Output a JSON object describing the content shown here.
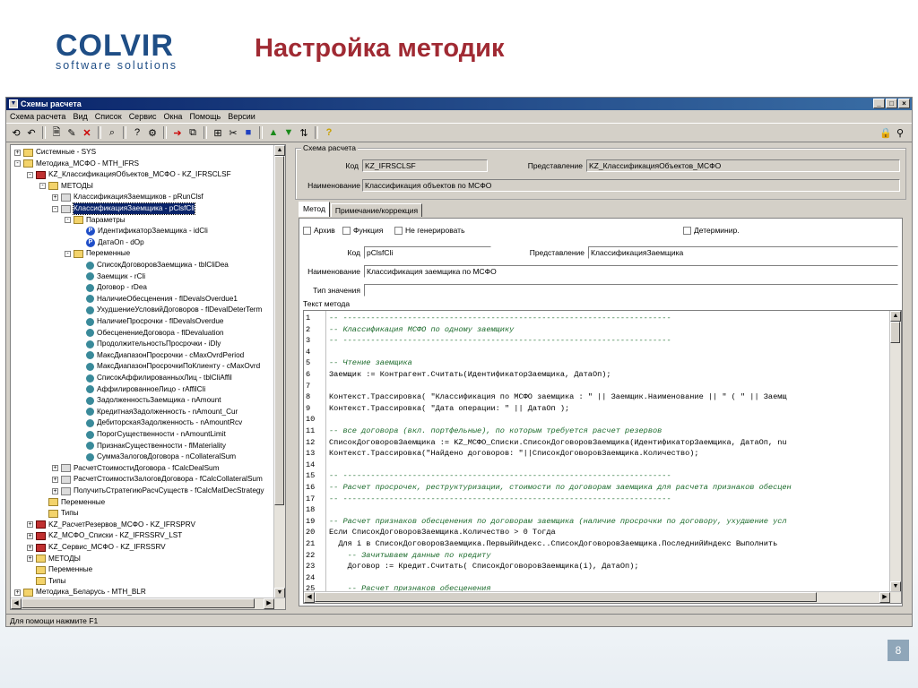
{
  "slide": {
    "logo_top": "COLVIR",
    "logo_bottom": "software solutions",
    "title": "Настройка методик",
    "page_number": "8"
  },
  "window": {
    "title": "Схемы расчета",
    "menu": [
      "Схема расчета",
      "Вид",
      "Список",
      "Сервис",
      "Окна",
      "Помощь",
      "Версии"
    ],
    "status": "Для помощи нажмите F1"
  },
  "tree": [
    {
      "text": "Системные - SYS",
      "indent": 0,
      "exp": "+",
      "icon": "folder"
    },
    {
      "text": "Методика_МСФО - MTH_IFRS",
      "indent": 0,
      "exp": "-",
      "icon": "folder"
    },
    {
      "text": "KZ_КлассификацияОбъектов_МСФО - KZ_IFRSCLSF",
      "indent": 1,
      "exp": "-",
      "icon": "db"
    },
    {
      "text": "МЕТОДЫ",
      "indent": 2,
      "exp": "-",
      "icon": "folder"
    },
    {
      "text": "КлассификацияЗаемщиков - pRunClsf",
      "indent": 3,
      "exp": "+",
      "icon": "paper"
    },
    {
      "text": "КлассификацияЗаемщика - pClsfCli",
      "indent": 3,
      "exp": "-",
      "icon": "paper",
      "selected": true
    },
    {
      "text": "Параметры",
      "indent": 4,
      "exp": "-",
      "icon": "folder"
    },
    {
      "text": "ИдентификаторЗаемщика - idCli",
      "indent": 5,
      "exp": "",
      "icon": "p"
    },
    {
      "text": "ДатаОп - dOp",
      "indent": 5,
      "exp": "",
      "icon": "p"
    },
    {
      "text": "Переменные",
      "indent": 4,
      "exp": "-",
      "icon": "folder"
    },
    {
      "text": "СписокДоговоровЗаемщика - tblCliDea",
      "indent": 5,
      "exp": "",
      "icon": "gear"
    },
    {
      "text": "Заемщик - rCli",
      "indent": 5,
      "exp": "",
      "icon": "gear"
    },
    {
      "text": "Договор - rDea",
      "indent": 5,
      "exp": "",
      "icon": "gear"
    },
    {
      "text": "НаличиеОбесценения - flDevalsOverdue1",
      "indent": 5,
      "exp": "",
      "icon": "gear"
    },
    {
      "text": "УхудшениеУсловийДоговоров - flDevalDeterTerm",
      "indent": 5,
      "exp": "",
      "icon": "gear"
    },
    {
      "text": "НаличиеПросрочки - flDevalsOverdue",
      "indent": 5,
      "exp": "",
      "icon": "gear"
    },
    {
      "text": "ОбесценениеДоговора - flDevaluation",
      "indent": 5,
      "exp": "",
      "icon": "gear"
    },
    {
      "text": "ПродолжительностьПросрочки - iDly",
      "indent": 5,
      "exp": "",
      "icon": "gear"
    },
    {
      "text": "МаксДиапазонПросрочки - cMaxOvrdPeriod",
      "indent": 5,
      "exp": "",
      "icon": "gear"
    },
    {
      "text": "МаксДиапазонПросрочкиПоКлиенту - cMaxOvrd",
      "indent": 5,
      "exp": "",
      "icon": "gear"
    },
    {
      "text": "СписокАффилированныхЛиц - tblCliAffil",
      "indent": 5,
      "exp": "",
      "icon": "gear"
    },
    {
      "text": "АффилированноеЛицо - rAffilCli",
      "indent": 5,
      "exp": "",
      "icon": "gear"
    },
    {
      "text": "ЗадолженностьЗаемщика - nAmount",
      "indent": 5,
      "exp": "",
      "icon": "gear"
    },
    {
      "text": "КредитнаяЗадолженность - nAmount_Cur",
      "indent": 5,
      "exp": "",
      "icon": "gear"
    },
    {
      "text": "ДебиторскаяЗадолженность - nAmountRcv",
      "indent": 5,
      "exp": "",
      "icon": "gear"
    },
    {
      "text": "ПорогСущественности - nAmountLimit",
      "indent": 5,
      "exp": "",
      "icon": "gear"
    },
    {
      "text": "ПризнакСущественности - flMateriality",
      "indent": 5,
      "exp": "",
      "icon": "gear"
    },
    {
      "text": "СуммаЗалоговДоговора - nCollateralSum",
      "indent": 5,
      "exp": "",
      "icon": "gear"
    },
    {
      "text": "РасчетСтоимостиДоговора - fCalcDealSum",
      "indent": 3,
      "exp": "+",
      "icon": "paper"
    },
    {
      "text": "РасчетСтоимостиЗалоговДоговора - fCalcCollateralSum",
      "indent": 3,
      "exp": "+",
      "icon": "paper"
    },
    {
      "text": "ПолучитьСтратегиюРасчСуществ - fCalcMatDecStrategy",
      "indent": 3,
      "exp": "+",
      "icon": "paper"
    },
    {
      "text": "Переменные",
      "indent": 2,
      "exp": "",
      "icon": "folder"
    },
    {
      "text": "Типы",
      "indent": 2,
      "exp": "",
      "icon": "folder"
    },
    {
      "text": "KZ_РасчетРезервов_МСФО - KZ_IFRSPRV",
      "indent": 1,
      "exp": "+",
      "icon": "db"
    },
    {
      "text": "KZ_МСФО_Списки - KZ_IFRSSRV_LST",
      "indent": 1,
      "exp": "+",
      "icon": "db"
    },
    {
      "text": "KZ_Сервис_МСФО - KZ_IFRSSRV",
      "indent": 1,
      "exp": "+",
      "icon": "db"
    },
    {
      "text": "МЕТОДЫ",
      "indent": 1,
      "exp": "+",
      "icon": "folder"
    },
    {
      "text": "Переменные",
      "indent": 1,
      "exp": "",
      "icon": "folder"
    },
    {
      "text": "Типы",
      "indent": 1,
      "exp": "",
      "icon": "folder"
    },
    {
      "text": "Методика_Беларусь - MTH_BLR",
      "indent": 0,
      "exp": "+",
      "icon": "folder"
    }
  ],
  "scheme": {
    "legend": "Схема расчета",
    "code_label": "Код",
    "code_value": "KZ_IFRSCLSF",
    "repr_label": "Представление",
    "repr_value": "KZ_КлассификацияОбъектов_МСФО",
    "name_label": "Наименование",
    "name_value": "Классификация объектов по МСФО"
  },
  "tabs": [
    "Метод",
    "Примечание/коррекция"
  ],
  "method": {
    "archive": "Архив",
    "function": "Функция",
    "no_generate": "Не генерировать",
    "determ": "Детерминир.",
    "code_label": "Код",
    "code_value": "pClsfCli",
    "repr_label": "Представление",
    "repr_value": "КлассификацияЗаемщика",
    "name_label": "Наименование",
    "name_value": "Классификация заемщика по МСФО",
    "type_label": "Тип значения",
    "type_value": "",
    "text_legend": "Текст метода"
  },
  "code_lines": [
    {
      "n": "1",
      "t": "-- -----------------------------------------------------------------------",
      "c": true
    },
    {
      "n": "2",
      "t": "-- Классификация МСФО по одному заемщику",
      "c": true
    },
    {
      "n": "3",
      "t": "-- -----------------------------------------------------------------------",
      "c": true
    },
    {
      "n": "4",
      "t": "",
      "c": false
    },
    {
      "n": "5",
      "t": "-- Чтение заемщика",
      "c": true
    },
    {
      "n": "6",
      "t": "Заемщик := Контрагент.Считать(ИдентификаторЗаемщика, ДатаОп);",
      "c": false
    },
    {
      "n": "7",
      "t": "",
      "c": false
    },
    {
      "n": "8",
      "t": "Контекст.Трассировка( \"Классификация по МСФО заемщика : \" || Заемщик.Наименование || \" ( \" || Заемщ",
      "c": false
    },
    {
      "n": "9",
      "t": "Контекст.Трассировка( \"Дата операции: \" || ДатаОп );",
      "c": false
    },
    {
      "n": "10",
      "t": "",
      "c": false
    },
    {
      "n": "11",
      "t": "-- все договора (вкл. портфельные), по которым требуется расчет резервов",
      "c": true
    },
    {
      "n": "12",
      "t": "СписокДоговоровЗаемщика := KZ_МСФО_Списки.СписокДоговоровЗаемщика(ИдентификаторЗаемщика, ДатаОп, nu",
      "c": false
    },
    {
      "n": "13",
      "t": "Контекст.Трассировка(\"Найдено договоров: \"||СписокДоговоровЗаемщика.Количество);",
      "c": false
    },
    {
      "n": "14",
      "t": "",
      "c": false
    },
    {
      "n": "15",
      "t": "-- -----------------------------------------------------------------------",
      "c": true
    },
    {
      "n": "16",
      "t": "-- Расчет просрочек, реструктуризации, стоимости по договорам заемщика для расчета признаков обесцен",
      "c": true
    },
    {
      "n": "17",
      "t": "-- -----------------------------------------------------------------------",
      "c": true
    },
    {
      "n": "18",
      "t": "",
      "c": false
    },
    {
      "n": "19",
      "t": "-- Расчет признаков обесценения по договорам заемщика (наличие просрочки по договору, ухудшение усл",
      "c": true
    },
    {
      "n": "20",
      "t": "Если СписокДоговоровЗаемщика.Количество > 0 Тогда",
      "c": false
    },
    {
      "n": "21",
      "t": "  Для i в СписокДоговоровЗаемщика.ПервыйИндекс..СписокДоговоровЗаемщика.ПоследнийИндекс Выполнить",
      "c": false
    },
    {
      "n": "22",
      "t": "    -- Зачитываем данные по кредиту",
      "c": true
    },
    {
      "n": "23",
      "t": "    Договор := Кредит.Считать( СписокДоговоровЗаемщика(i), ДатаОп);",
      "c": false
    },
    {
      "n": "24",
      "t": "",
      "c": false
    },
    {
      "n": "25",
      "t": "    -- Расчет признаков обесценения",
      "c": true
    }
  ]
}
